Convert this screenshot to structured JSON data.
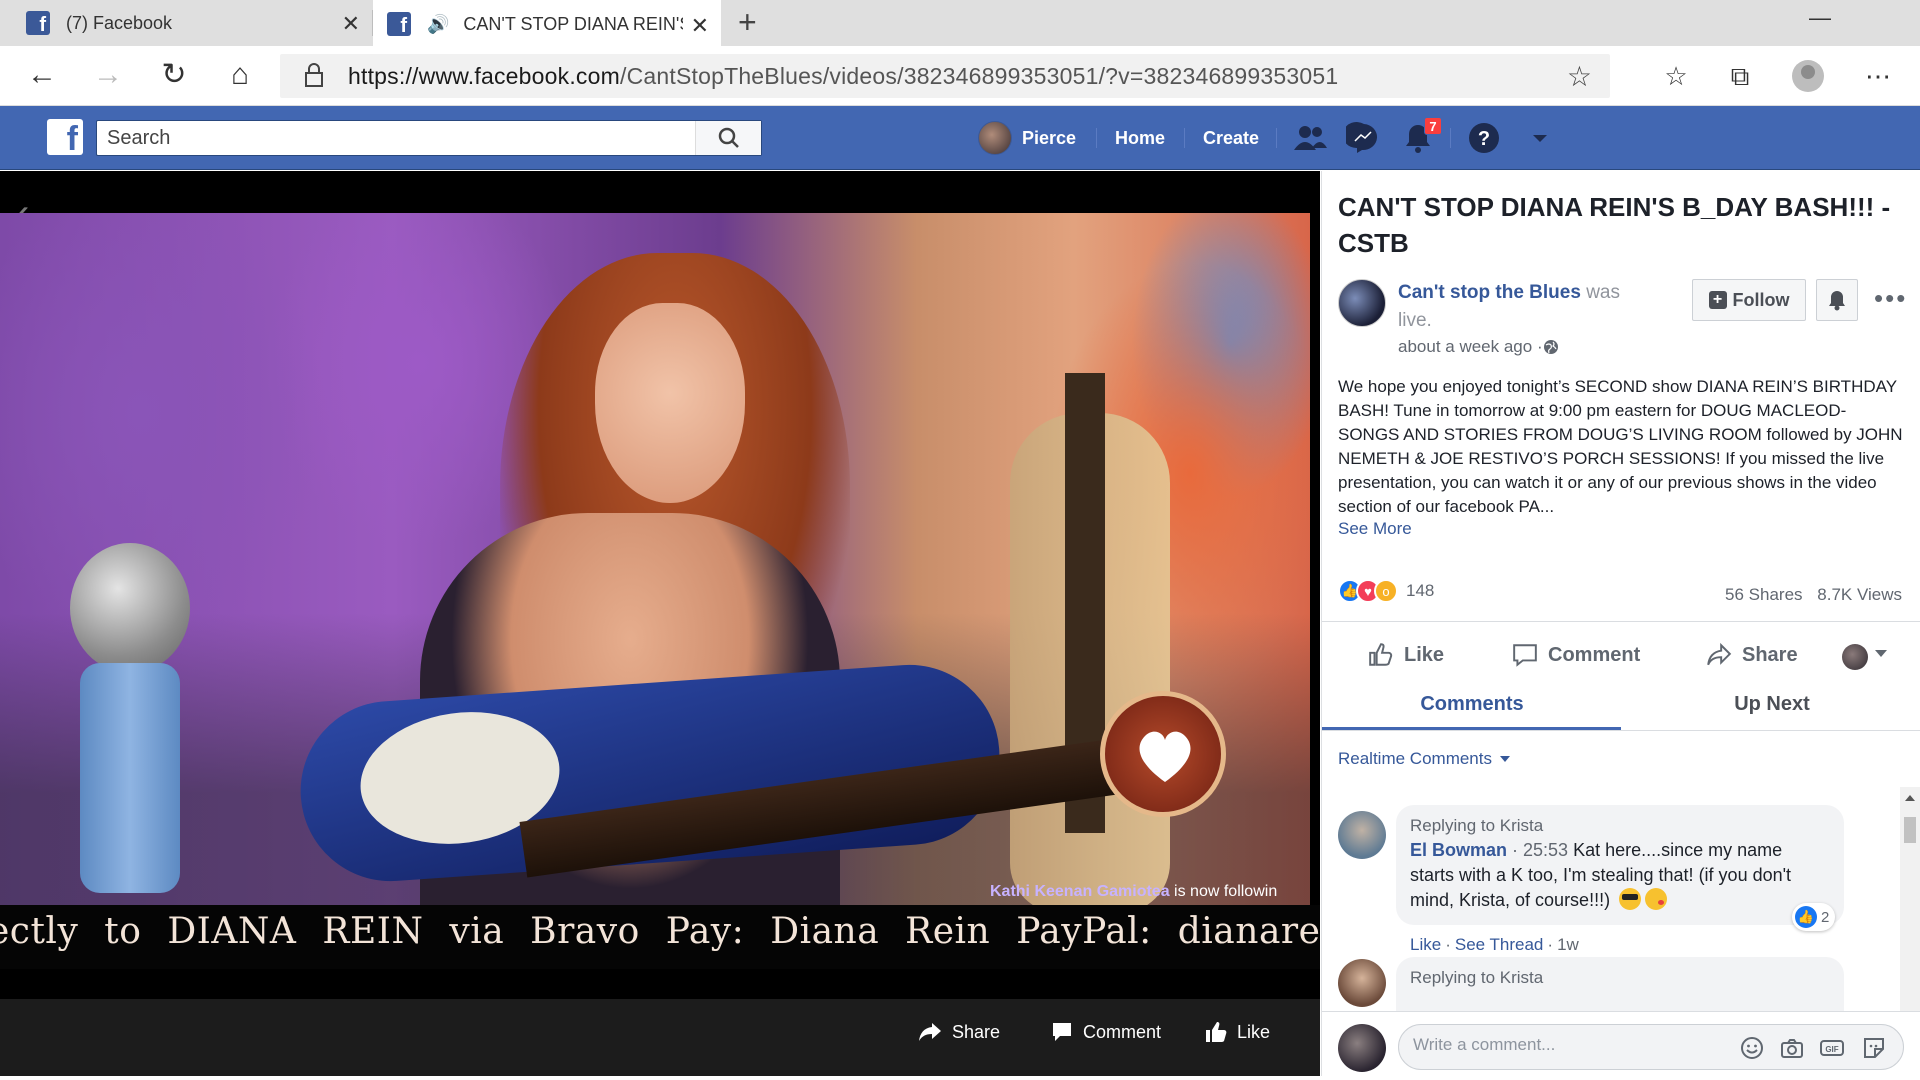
{
  "browser": {
    "tabs": [
      {
        "title": "(7) Facebook"
      },
      {
        "title": "CAN'T STOP DIANA REIN'S B_DAY BASH!!! - CSTB"
      }
    ],
    "tab_close": "✕",
    "new_tab": "+",
    "window_controls": {
      "minimize": "—",
      "maximize": "❐",
      "close": "✕"
    },
    "url_prefix": "https://www.facebook.com",
    "url_path": "/CantStopTheBlues/videos/382346899353051/?v=382346899353051"
  },
  "fb": {
    "logo": "f",
    "search_placeholder": "Search",
    "nav": {
      "profile": "Pierce",
      "home": "Home",
      "create": "Create"
    },
    "notifications_count": "7"
  },
  "video": {
    "ticker": "ectly to  DIANA REIN  via  Bravo Pay:  Diana Rein  PayPal:  dianarein@gmai",
    "follow_note_name": "Kathi Keenan Gamiotea",
    "follow_note_text": " is now followin",
    "actions": {
      "share": "Share",
      "comment": "Comment",
      "like": "Like"
    }
  },
  "post": {
    "title": "CAN'T STOP DIANA REIN'S B_DAY BASH!!! - CSTB",
    "page_name": "Can't stop the Blues",
    "was_live": " was live.",
    "time_ago": "about a week ago · ",
    "follow_label": "Follow",
    "more": "•••",
    "body": "We hope you enjoyed tonight’s SECOND show DIANA REIN’S BIRTHDAY BASH! Tune in tomorrow at 9:00 pm eastern for DOUG MACLEOD- SONGS AND STORIES FROM DOUG’S LIVING ROOM followed by JOHN NEMETH & JOE RESTIVO’S PORCH SESSIONS! If you missed the live presentation, you can watch it or any of our previous shows in the video section of our facebook PA...",
    "see_more": "See More",
    "reactions_count": "148",
    "shares": "56 Shares",
    "views": "8.7K Views",
    "actions": {
      "like": "Like",
      "comment": "Comment",
      "share": "Share"
    },
    "tabs": {
      "comments": "Comments",
      "up_next": "Up Next"
    },
    "realtime_label": "Realtime Comments"
  },
  "comments": [
    {
      "replying": "Replying to Krista",
      "name": "El Bowman",
      "time": " · 25:53 ",
      "text": "Kat here....since my name starts with a K too, I'm stealing that! (if you don't mind, Krista, of course!!!)",
      "likes": "2",
      "like_label": "Like",
      "thread_label": "See Thread",
      "ago": "1w"
    },
    {
      "replying": "Replying to Krista"
    }
  ],
  "composer": {
    "placeholder": "Write a comment..."
  }
}
